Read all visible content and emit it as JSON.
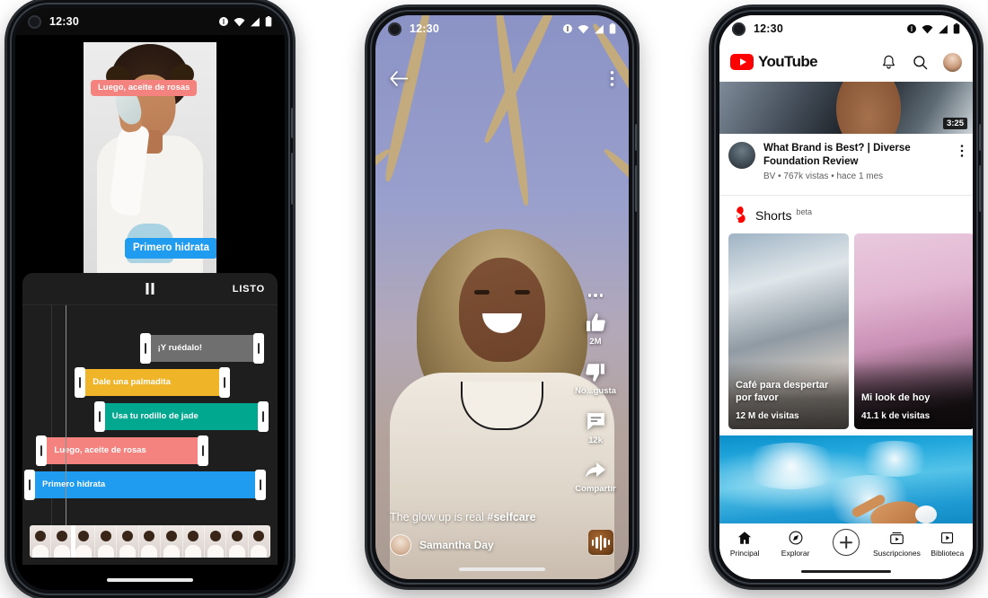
{
  "page": {
    "background": "#ffffff"
  },
  "status_bar": {
    "time": "12:30",
    "icons": [
      "dnd-icon",
      "wifi-icon",
      "signal-icon",
      "battery-icon"
    ]
  },
  "editor_phone": {
    "name": "video-editor",
    "preview": {
      "overlay_tags": [
        {
          "label": "Luego, aceite de rosas",
          "color": "#f4827e"
        },
        {
          "label": "Primero hidrata",
          "color": "#1f9bf0"
        }
      ]
    },
    "toolbar": {
      "pause_label": "pause-icon",
      "done_label": "LISTO"
    },
    "timeline": {
      "clips": [
        {
          "label": "¡Y ruédalo!",
          "color": "#6f6f6f",
          "left_pct": 48,
          "width_pct": 47
        },
        {
          "label": "Dale una palmadita",
          "color": "#f0b429",
          "left_pct": 21,
          "width_pct": 60
        },
        {
          "label": "Usa tu rodillo de jade",
          "color": "#00a88f",
          "left_pct": 29,
          "width_pct": 68
        },
        {
          "label": "Luego, aceite de rosas",
          "color": "#f4827e",
          "left_pct": 5,
          "width_pct": 67
        },
        {
          "label": "Primero hidrata",
          "color": "#1f9bf0",
          "left_pct": 0,
          "width_pct": 96
        }
      ],
      "filmstrip_frames": 11,
      "playhead_position_pct": 17
    }
  },
  "shorts_phone": {
    "name": "shorts-player",
    "top_bar": {
      "back": "back-arrow-icon",
      "menu": "more-vertical-icon"
    },
    "actions": [
      {
        "icon": "more-horizontal-icon",
        "label": ""
      },
      {
        "icon": "thumbs-up-icon",
        "label": "2M"
      },
      {
        "icon": "thumbs-down-icon",
        "label": "No...gusta"
      },
      {
        "icon": "comment-icon",
        "label": "12k"
      },
      {
        "icon": "share-icon",
        "label": "Compartir"
      }
    ],
    "caption_plain": "The glow up is real ",
    "caption_hashtag": "#selfcare",
    "author": "Samantha Day",
    "audio_button": "audio-waveform-icon"
  },
  "youtube_phone": {
    "name": "youtube-home",
    "header": {
      "brand": "YouTube",
      "icons": [
        "notifications-bell-icon",
        "search-icon",
        "account-avatar"
      ]
    },
    "featured_video": {
      "duration": "3:25",
      "title": "What Brand is Best? | Diverse Foundation Review",
      "subtitle": "BV • 767k vistas • hace 1 mes",
      "menu": "kebab-menu-icon"
    },
    "shorts_section": {
      "title": "Shorts",
      "badge": "beta",
      "cards": [
        {
          "title": "Café para despertar por favor",
          "views": "12 M de visitas"
        },
        {
          "title": "Mi look de hoy",
          "views": "41.1 k de visitas"
        },
        {
          "title": "",
          "views": ""
        }
      ]
    },
    "bottom_nav": [
      {
        "label": "Principal",
        "icon": "home-icon"
      },
      {
        "label": "Explorar",
        "icon": "compass-icon"
      },
      {
        "label": "",
        "icon": "create-plus-icon"
      },
      {
        "label": "Suscripciones",
        "icon": "subscriptions-icon"
      },
      {
        "label": "Biblioteca",
        "icon": "library-icon"
      }
    ]
  }
}
